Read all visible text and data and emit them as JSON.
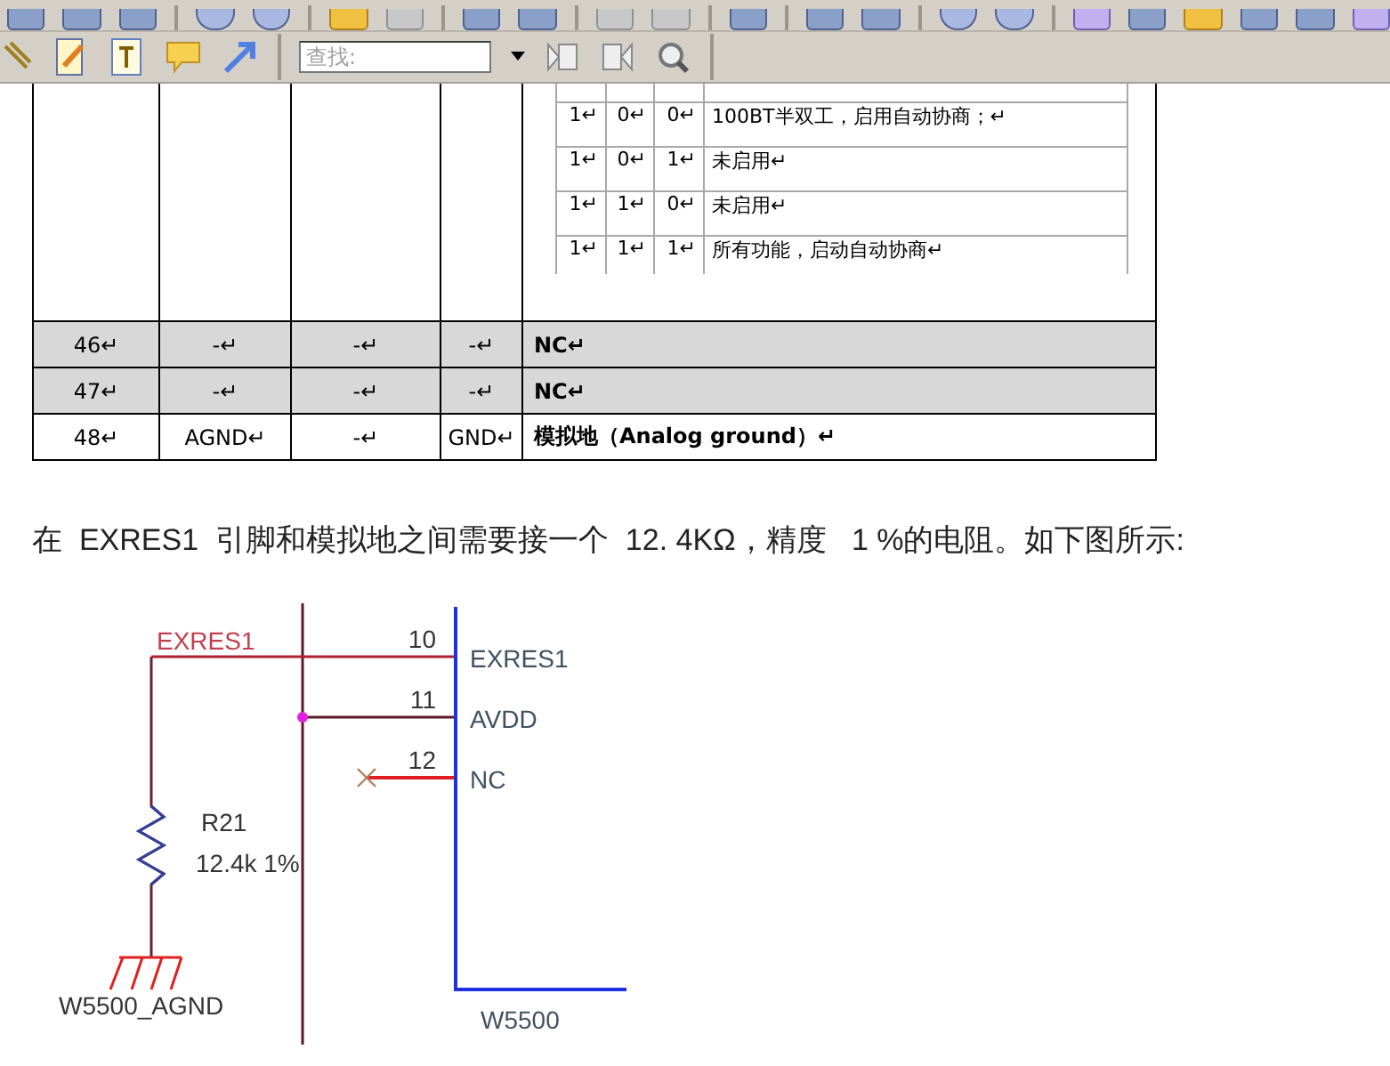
{
  "toolbar": {
    "search": {
      "placeholder": "查找:"
    }
  },
  "table": {
    "nested_rows": [
      [
        "1↵",
        "0↵",
        "0↵",
        "100BT半双工，启用自动协商；↵"
      ],
      [
        "1↵",
        "0↵",
        "1↵",
        "未启用↵"
      ],
      [
        "1↵",
        "1↵",
        "0↵",
        "未启用↵"
      ],
      [
        "1↵",
        "1↵",
        "1↵",
        "所有功能，启动自动协商↵"
      ]
    ],
    "rows": [
      {
        "cells": [
          "46↵",
          "-↵",
          "-↵",
          "-↵",
          "NC↵"
        ],
        "shaded": true
      },
      {
        "cells": [
          "47↵",
          "-↵",
          "-↵",
          "-↵",
          "NC↵"
        ],
        "shaded": true
      },
      {
        "cells": [
          "48↵",
          "AGND↵",
          "-↵",
          "GND↵",
          "模拟地（Analog ground）↵"
        ],
        "shaded": false
      }
    ]
  },
  "paragraph": "在  EXRES1  引脚和模拟地之间需要接一个  12. 4KΩ，精度   1 %的电阻。如下图所示:",
  "schematic": {
    "net_label": "EXRES1",
    "resistor": {
      "ref": "R21",
      "value": "12.4k 1%"
    },
    "ground_label": "W5500_AGND",
    "chip_label": "W5500",
    "pins": [
      {
        "number": "10",
        "name": "EXRES1",
        "kind": "net"
      },
      {
        "number": "11",
        "name": "AVDD",
        "kind": "junction"
      },
      {
        "number": "12",
        "name": "NC",
        "kind": "noconnect"
      }
    ]
  }
}
